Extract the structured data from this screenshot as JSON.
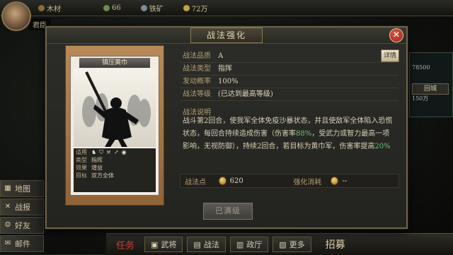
{
  "topbar": {
    "resources": [
      {
        "label": "木材",
        "value": "",
        "color": "#8d6b3a"
      },
      {
        "label": "",
        "value": "66",
        "color": "#6d8a4f"
      },
      {
        "label": "铁矿",
        "value": "",
        "color": "#7b8c96"
      },
      {
        "label": "",
        "value": "72万",
        "color": "#c5a440"
      }
    ]
  },
  "player": {
    "name_badge": "君臣"
  },
  "left_menu": [
    {
      "icon": "map-icon",
      "label": "地图"
    },
    {
      "icon": "battle-icon",
      "label": "战报"
    },
    {
      "icon": "friends-icon",
      "label": "好友"
    },
    {
      "icon": "mail-icon",
      "label": "邮件"
    }
  ],
  "right_panel": {
    "lines": [
      "78500",
      "150万"
    ],
    "button": "回城"
  },
  "bottom_bar": {
    "items": [
      "任务",
      "武将",
      "战法",
      "政厅",
      "更多",
      "招募"
    ]
  },
  "modal": {
    "title": "战法强化",
    "close_label": "✕",
    "card": {
      "name": "镇压黄巾",
      "attrs": [
        {
          "key": "适用",
          "value": ""
        },
        {
          "key": "类型",
          "value": "指挥"
        },
        {
          "key": "效果",
          "value": "增益"
        },
        {
          "key": "目标",
          "value": "双方全体"
        }
      ]
    },
    "info": [
      {
        "key": "战法品质",
        "value": "A"
      },
      {
        "key": "战法类型",
        "value": "指挥"
      },
      {
        "key": "发动概率",
        "value": "100%"
      },
      {
        "key": "战法等级",
        "value": "(已达到最高等级)"
      }
    ],
    "detail_button": "详情",
    "description_title": "战法说明",
    "description": {
      "p1": "战斗第2回合，使我军全体免疫沙暴状态，并且使敌军全体陷入恐慌状态，每回合持续造成伤害（伤害率",
      "g1": "88%",
      "p2": "，受武力或智力最高一项影响，无视防御），持续2回合，若目标为黄巾军，伤害率提高",
      "g2": "20%"
    },
    "points_label": "战法点",
    "points_value": "620",
    "cost_label": "强化消耗",
    "cost_value": "--",
    "strengthen_button": "已满级"
  }
}
